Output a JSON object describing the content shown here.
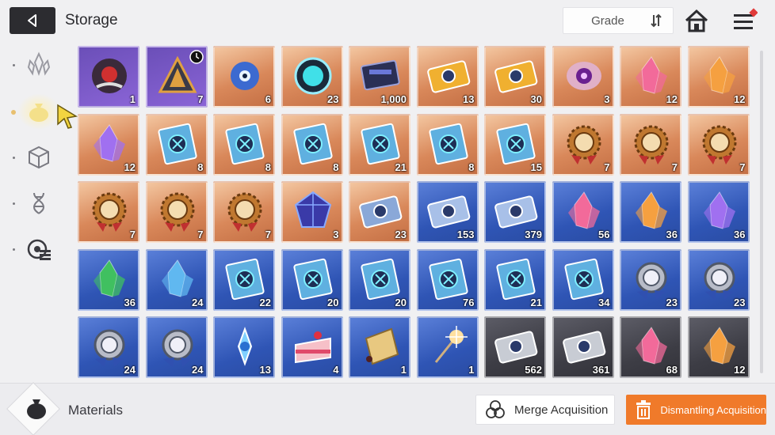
{
  "header": {
    "title": "Storage",
    "grade_label": "Grade"
  },
  "sidebar": {
    "items": [
      {
        "name": "crystal-category-icon",
        "active": false
      },
      {
        "name": "material-bag-category-icon",
        "active": true
      },
      {
        "name": "cube-category-icon",
        "active": false
      },
      {
        "name": "dna-category-icon",
        "active": false
      },
      {
        "name": "target-list-category-icon",
        "active": false
      }
    ]
  },
  "grid": {
    "items": [
      {
        "icon": "dark-flower-icon",
        "rarity": "epic",
        "count": "1"
      },
      {
        "icon": "pyramid-artifact-icon",
        "rarity": "epic",
        "count": "7",
        "timer": true
      },
      {
        "icon": "blue-eye-creature-icon",
        "rarity": "orange",
        "count": "6"
      },
      {
        "icon": "cyan-orb-device-icon",
        "rarity": "orange",
        "count": "23"
      },
      {
        "icon": "memory-chip-icon",
        "rarity": "orange",
        "count": "1,000"
      },
      {
        "icon": "gold-ticket-icon",
        "rarity": "orange",
        "count": "13"
      },
      {
        "icon": "gold-compass-ticket-icon",
        "rarity": "orange",
        "count": "30"
      },
      {
        "icon": "purple-eye-core-icon",
        "rarity": "orange",
        "count": "3"
      },
      {
        "icon": "pink-crystal-icon",
        "rarity": "orange",
        "count": "12"
      },
      {
        "icon": "orange-crystal-icon",
        "rarity": "orange",
        "count": "12"
      },
      {
        "icon": "purple-crystal-icon",
        "rarity": "orange",
        "count": "12"
      },
      {
        "icon": "skill-book-x-icon",
        "rarity": "orange",
        "count": "8"
      },
      {
        "icon": "skill-book-shield-icon",
        "rarity": "orange",
        "count": "8"
      },
      {
        "icon": "skill-book-eye-icon",
        "rarity": "orange",
        "count": "8"
      },
      {
        "icon": "skill-book-star-icon",
        "rarity": "orange",
        "count": "21"
      },
      {
        "icon": "skill-book-cross-icon",
        "rarity": "orange",
        "count": "8"
      },
      {
        "icon": "skill-book-knot-icon",
        "rarity": "orange",
        "count": "15"
      },
      {
        "icon": "gear-medal-plus-icon",
        "rarity": "orange",
        "count": "7"
      },
      {
        "icon": "gear-medal-shield-icon",
        "rarity": "orange",
        "count": "7"
      },
      {
        "icon": "gear-medal-eye-icon",
        "rarity": "orange",
        "count": "7"
      },
      {
        "icon": "gear-medal-star-icon",
        "rarity": "orange",
        "count": "7"
      },
      {
        "icon": "gear-medal-compass-icon",
        "rarity": "orange",
        "count": "7"
      },
      {
        "icon": "gear-medal-knot-icon",
        "rarity": "orange",
        "count": "7"
      },
      {
        "icon": "dark-cube-gem-icon",
        "rarity": "orange",
        "count": "3"
      },
      {
        "icon": "music-note-ticket-icon",
        "rarity": "orange",
        "count": "23"
      },
      {
        "icon": "silver-ticket-icon",
        "rarity": "blue",
        "count": "153"
      },
      {
        "icon": "silver-compass-ticket-icon",
        "rarity": "blue",
        "count": "379"
      },
      {
        "icon": "pink-crystal-icon",
        "rarity": "blue",
        "count": "56"
      },
      {
        "icon": "orange-crystal-icon",
        "rarity": "blue",
        "count": "36"
      },
      {
        "icon": "purple-crystal-icon",
        "rarity": "blue",
        "count": "36"
      },
      {
        "icon": "green-crystal-icon",
        "rarity": "blue",
        "count": "36"
      },
      {
        "icon": "blue-crystal-icon",
        "rarity": "blue",
        "count": "24"
      },
      {
        "icon": "skill-book-x-icon",
        "rarity": "blue",
        "count": "22"
      },
      {
        "icon": "skill-book-shield-icon",
        "rarity": "blue",
        "count": "20"
      },
      {
        "icon": "skill-book-eye-icon",
        "rarity": "blue",
        "count": "20"
      },
      {
        "icon": "skill-book-star-icon",
        "rarity": "blue",
        "count": "76"
      },
      {
        "icon": "skill-book-cross-icon",
        "rarity": "blue",
        "count": "21"
      },
      {
        "icon": "skill-book-knot-icon",
        "rarity": "blue",
        "count": "34"
      },
      {
        "icon": "silver-medal-plus-icon",
        "rarity": "blue",
        "count": "23"
      },
      {
        "icon": "silver-medal-shield-icon",
        "rarity": "blue",
        "count": "23"
      },
      {
        "icon": "silver-medal-eye-icon",
        "rarity": "blue",
        "count": "24"
      },
      {
        "icon": "silver-medal-compass-icon",
        "rarity": "blue",
        "count": "24"
      },
      {
        "icon": "ice-shard-icon",
        "rarity": "blue",
        "count": "13"
      },
      {
        "icon": "strawberry-cake-icon",
        "rarity": "blue",
        "count": "4"
      },
      {
        "icon": "gold-tag-icon",
        "rarity": "blue",
        "count": "1"
      },
      {
        "icon": "sparkler-icon",
        "rarity": "blue",
        "count": "1"
      },
      {
        "icon": "gray-ticket-icon",
        "rarity": "gray",
        "count": "562"
      },
      {
        "icon": "gray-compass-ticket-icon",
        "rarity": "gray",
        "count": "361"
      },
      {
        "icon": "pink-crystal-icon",
        "rarity": "gray",
        "count": "68"
      },
      {
        "icon": "orange-crystal-icon",
        "rarity": "gray",
        "count": "12"
      }
    ]
  },
  "footer": {
    "category_label": "Materials",
    "merge_label": "Merge Acquisition",
    "dismantle_label": "Dismantling Acquisition"
  },
  "colors": {
    "accent_orange": "#f07a2a",
    "dark_button": "#2c2c30",
    "notification_red": "#e03a3a"
  }
}
